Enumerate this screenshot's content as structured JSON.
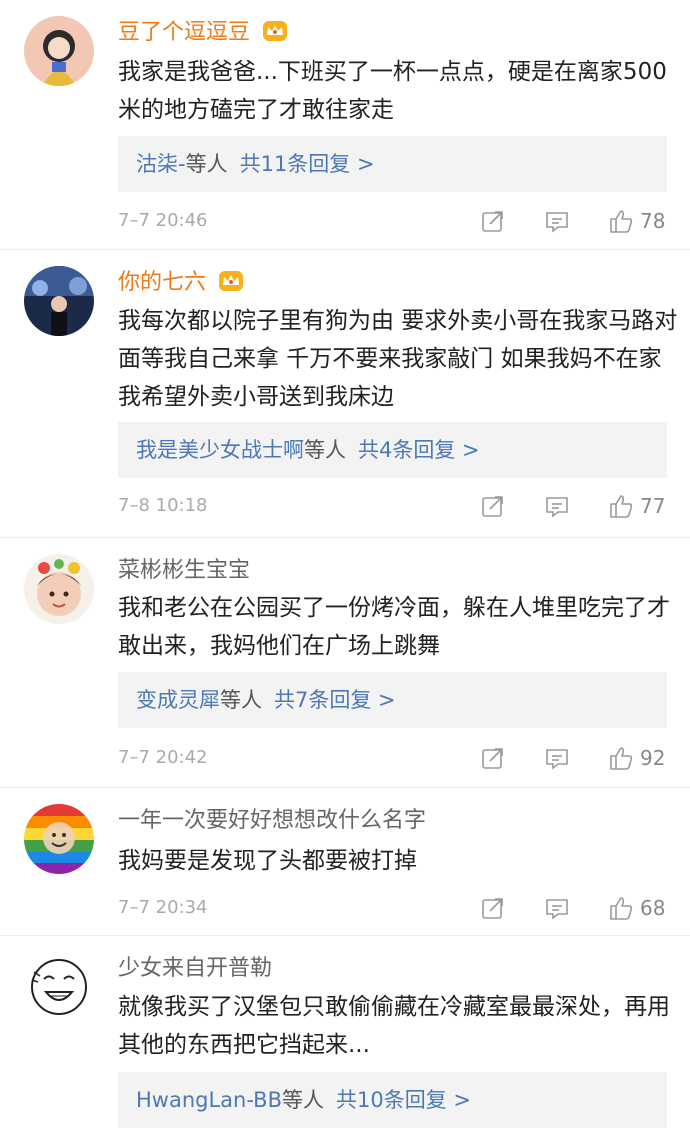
{
  "comments": [
    {
      "username": "豆了个逗逗豆",
      "vip": true,
      "text": "我家是我爸爸...下班买了一杯一点点，硬是在离家500米的地方磕完了才敢往家走",
      "replies": {
        "users": "沽柒-",
        "et": "等人",
        "count": "共11条回复 >"
      },
      "time": "7–7 20:46",
      "likes": "78"
    },
    {
      "username": "你的七六",
      "vip": true,
      "text": "我每次都以院子里有狗为由 要求外卖小哥在我家马路对面等我自己来拿 千万不要来我家敲门 如果我妈不在家 我希望外卖小哥送到我床边",
      "replies": {
        "users": "我是美少女战士啊",
        "et": "等人",
        "count": "共4条回复 >"
      },
      "time": "7–8 10:18",
      "likes": "77"
    },
    {
      "username": "菜彬彬生宝宝",
      "vip": false,
      "text": "我和老公在公园买了一份烤冷面，躲在人堆里吃完了才敢出来，我妈他们在广场上跳舞",
      "replies": {
        "users": "变成灵犀",
        "et": "等人",
        "count": "共7条回复 >"
      },
      "time": "7–7 20:42",
      "likes": "92"
    },
    {
      "username": "一年一次要好好想想改什么名字",
      "vip": false,
      "text": "我妈要是发现了头都要被打掉",
      "replies": null,
      "time": "7–7 20:34",
      "likes": "68"
    },
    {
      "username": "少女来自开普勒",
      "vip": false,
      "text": "就像我买了汉堡包只敢偷偷藏在冷藏室最最深处，再用其他的东西把它挡起来...",
      "replies": {
        "users": "HwangLan-BB",
        "et": "等人",
        "count": "共10条回复 >"
      },
      "time": null,
      "likes": null
    }
  ],
  "colors": {
    "vip_name": "#f07a16",
    "link": "#4c78b5",
    "meta": "#aaaaaa",
    "reply_bg": "#f3f3f3"
  },
  "icons": [
    "crown-icon",
    "share-icon",
    "comment-icon",
    "like-icon"
  ]
}
